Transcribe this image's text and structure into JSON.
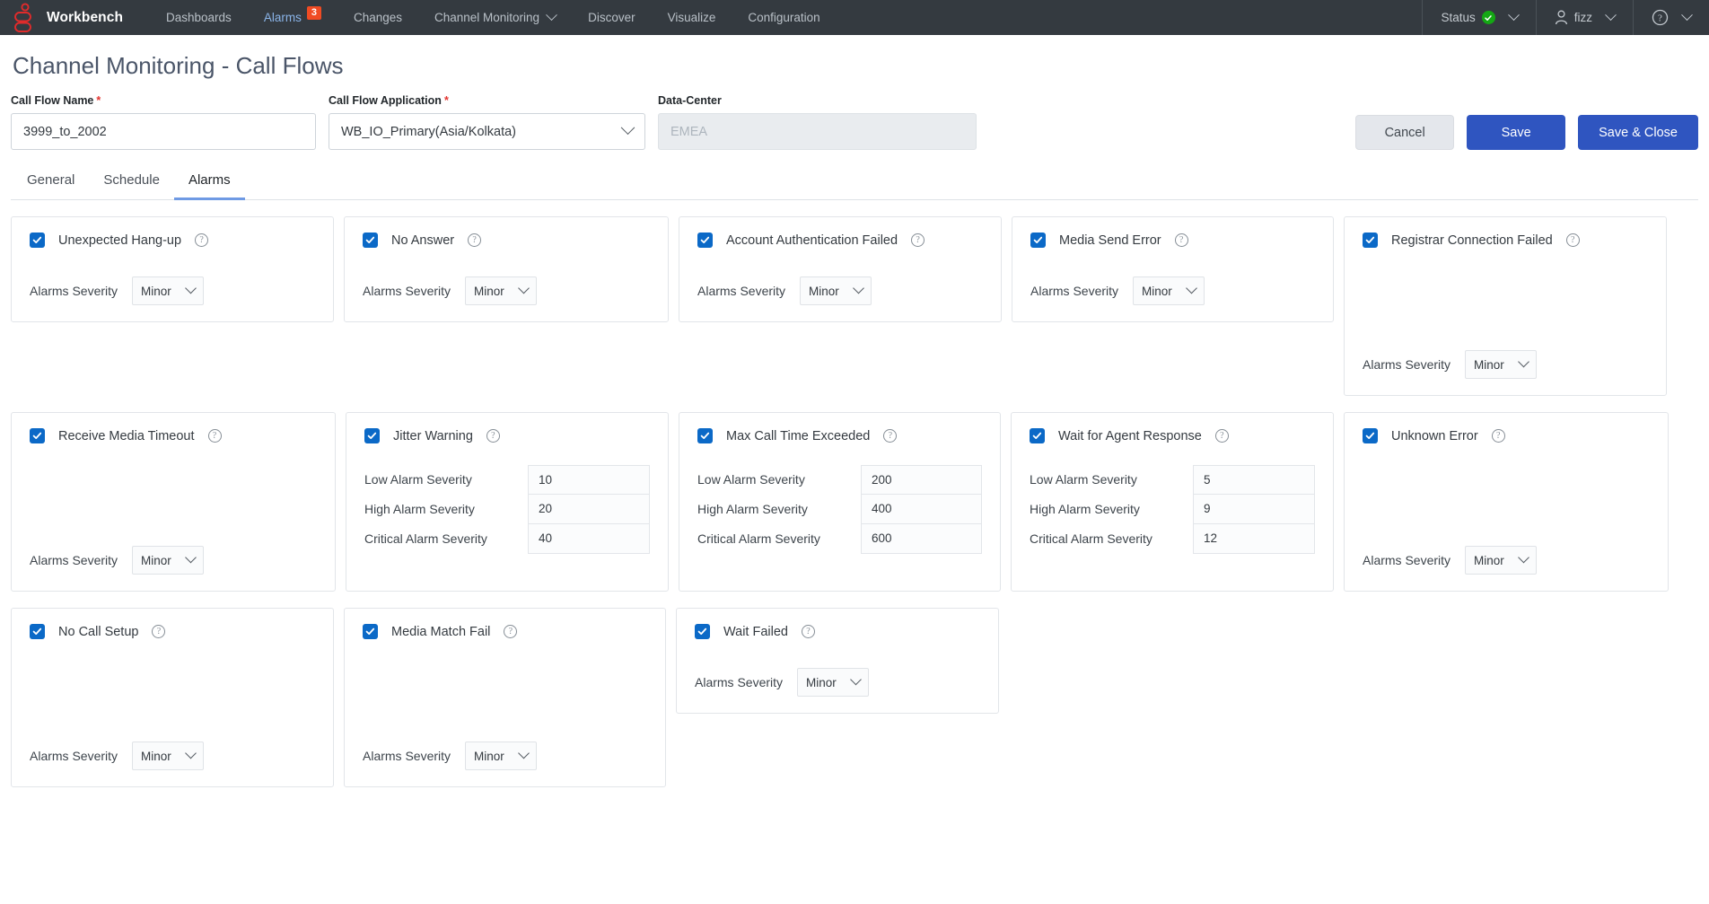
{
  "navbar": {
    "logo_name": "workbench-logo",
    "brand": "Workbench",
    "links": [
      {
        "label": "Dashboards",
        "active": false,
        "badge": null,
        "caret": false
      },
      {
        "label": "Alarms",
        "active": true,
        "badge": "3",
        "caret": false
      },
      {
        "label": "Changes",
        "active": false,
        "badge": null,
        "caret": false
      },
      {
        "label": "Channel Monitoring",
        "active": false,
        "badge": null,
        "caret": true
      },
      {
        "label": "Discover",
        "active": false,
        "badge": null,
        "caret": false
      },
      {
        "label": "Visualize",
        "active": false,
        "badge": null,
        "caret": false
      },
      {
        "label": "Configuration",
        "active": false,
        "badge": null,
        "caret": false
      }
    ],
    "status_label": "Status",
    "user_label": "fizz",
    "colors": {
      "background": "#343a40",
      "active_link": "#8ab4e8",
      "badge": "#f04b23",
      "status_ok": "#14a814"
    }
  },
  "page": {
    "title": "Channel Monitoring - Call Flows"
  },
  "form": {
    "call_flow_name": {
      "label": "Call Flow Name",
      "required": "*",
      "value": "3999_to_2002"
    },
    "call_flow_application": {
      "label": "Call Flow Application",
      "required": "*",
      "value": "WB_IO_Primary(Asia/Kolkata)"
    },
    "data_center": {
      "label": "Data-Center",
      "placeholder": "EMEA",
      "value": ""
    }
  },
  "actions": {
    "cancel": "Cancel",
    "save": "Save",
    "save_and_close": "Save & Close",
    "primary_color": "#2f55c0"
  },
  "tabs": [
    {
      "label": "General",
      "active": false
    },
    {
      "label": "Schedule",
      "active": false
    },
    {
      "label": "Alarms",
      "active": true
    }
  ],
  "labels": {
    "alarms_severity": "Alarms Severity",
    "low_alarm_severity": "Low Alarm Severity",
    "high_alarm_severity": "High Alarm Severity",
    "critical_alarm_severity": "Critical Alarm Severity"
  },
  "alarm_cards": [
    {
      "id": "unexpected-hang-up",
      "title": "Unexpected Hang-up",
      "checked": true,
      "type": "severity",
      "severity": "Minor",
      "row": 1
    },
    {
      "id": "no-answer",
      "title": "No Answer",
      "checked": true,
      "type": "severity",
      "severity": "Minor",
      "row": 1
    },
    {
      "id": "account-authentication-failed",
      "title": "Account Authentication Failed",
      "checked": true,
      "type": "severity",
      "severity": "Minor",
      "row": 1
    },
    {
      "id": "media-send-error",
      "title": "Media Send Error",
      "checked": true,
      "type": "severity",
      "severity": "Minor",
      "row": 1
    },
    {
      "id": "registrar-connection-failed",
      "title": "Registrar Connection Failed",
      "checked": true,
      "type": "severity",
      "severity": "Minor",
      "row": 2
    },
    {
      "id": "receive-media-timeout",
      "title": "Receive Media Timeout",
      "checked": true,
      "type": "severity",
      "severity": "Minor",
      "row": 2
    },
    {
      "id": "jitter-warning",
      "title": "Jitter Warning",
      "checked": true,
      "type": "thresholds",
      "thresholds": {
        "low": "10",
        "high": "20",
        "critical": "40"
      },
      "row": 2
    },
    {
      "id": "max-call-time-exceeded",
      "title": "Max Call Time Exceeded",
      "checked": true,
      "type": "thresholds",
      "thresholds": {
        "low": "200",
        "high": "400",
        "critical": "600"
      },
      "row": 2
    },
    {
      "id": "wait-for-agent-response",
      "title": "Wait for Agent Response",
      "checked": true,
      "type": "thresholds",
      "thresholds": {
        "low": "5",
        "high": "9",
        "critical": "12"
      },
      "row": 3
    },
    {
      "id": "unknown-error",
      "title": "Unknown Error",
      "checked": true,
      "type": "severity",
      "severity": "Minor",
      "row": 3
    },
    {
      "id": "no-call-setup",
      "title": "No Call Setup",
      "checked": true,
      "type": "severity",
      "severity": "Minor",
      "row": 3
    },
    {
      "id": "media-match-fail",
      "title": "Media Match Fail",
      "checked": true,
      "type": "severity",
      "severity": "Minor",
      "row": 3
    },
    {
      "id": "wait-failed",
      "title": "Wait Failed",
      "checked": true,
      "type": "severity",
      "severity": "Minor",
      "row": 4
    }
  ]
}
